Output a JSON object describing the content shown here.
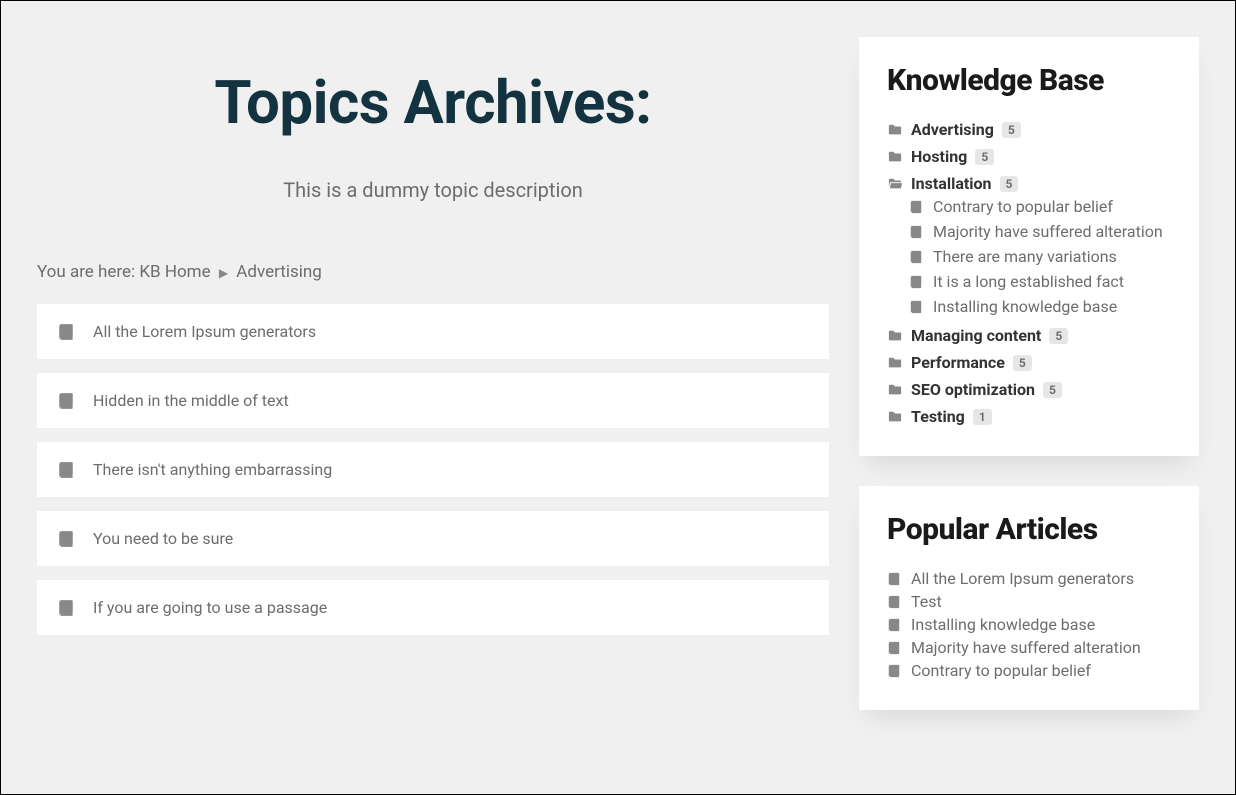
{
  "page": {
    "title": "Topics Archives:",
    "description": "This is a dummy topic description"
  },
  "breadcrumb": {
    "prefix": "You are here: ",
    "home": "KB Home",
    "current": "Advertising"
  },
  "articles": [
    "All the Lorem Ipsum generators",
    "Hidden in the middle of text",
    "There isn't anything embarrassing",
    "You need to be sure",
    "If you are going to use a passage"
  ],
  "kb": {
    "title": "Knowledge Base",
    "categories": [
      {
        "name": "Advertising",
        "count": "5",
        "open": false
      },
      {
        "name": "Hosting",
        "count": "5",
        "open": false
      },
      {
        "name": "Installation",
        "count": "5",
        "open": true,
        "children": [
          "Contrary to popular belief",
          "Majority have suffered alteration",
          "There are many variations",
          "It is a long established fact",
          "Installing knowledge base"
        ]
      },
      {
        "name": "Managing content",
        "count": "5",
        "open": false
      },
      {
        "name": "Performance",
        "count": "5",
        "open": false
      },
      {
        "name": "SEO optimization",
        "count": "5",
        "open": false
      },
      {
        "name": "Testing",
        "count": "1",
        "open": false
      }
    ]
  },
  "popular": {
    "title": "Popular Articles",
    "items": [
      "All the Lorem Ipsum generators",
      "Test",
      "Installing knowledge base",
      "Majority have suffered alteration",
      "Contrary to popular belief"
    ]
  },
  "icons": {
    "book": "book-icon",
    "folder": "folder-icon",
    "folder_open": "folder-open-icon",
    "caret": "caret-right-icon"
  },
  "colors": {
    "title": "#143340",
    "muted": "#6d6d6d",
    "panel": "#ffffff",
    "background": "#f0f0f0",
    "badge_bg": "#e6e6e6"
  }
}
